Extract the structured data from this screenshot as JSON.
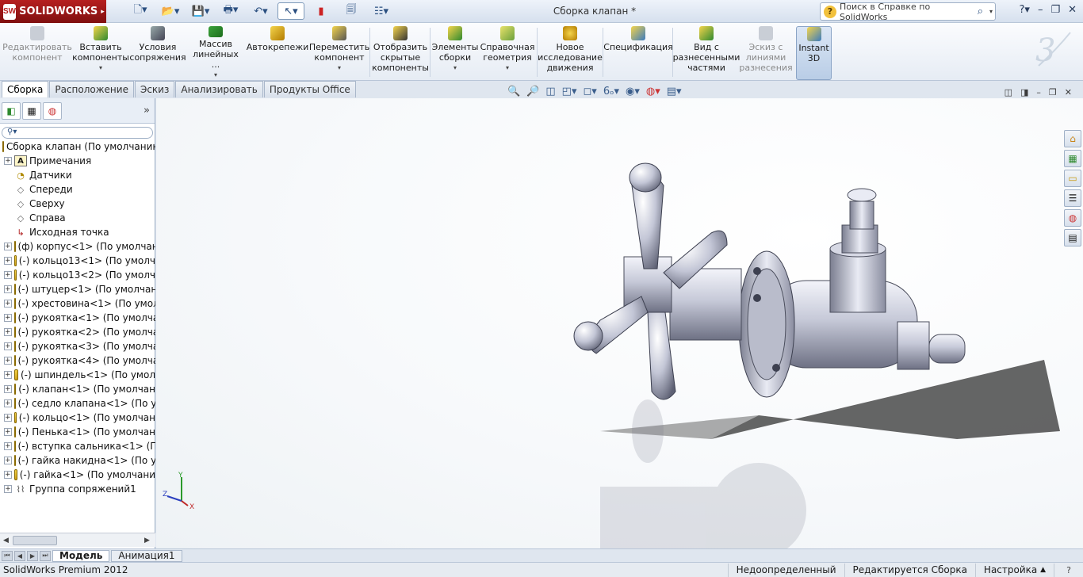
{
  "app": {
    "logo_text": "SOLIDWORKS",
    "logo_mark": "SW",
    "document_title": "Сборка клапан *"
  },
  "quick_access": [
    "new-icon",
    "open-icon",
    "save-icon",
    "print-icon",
    "undo-icon",
    "select-icon",
    "rebuild-icon",
    "file-props-icon",
    "options-icon"
  ],
  "search": {
    "placeholder": "Поиск в Справке по SolidWorks"
  },
  "ribbon": [
    {
      "label": "Редактировать\nкомпонент",
      "disabled": true
    },
    {
      "label": "Вставить\nкомпоненты",
      "dropdown": true
    },
    {
      "label": "Условия\nсопряжения"
    },
    {
      "label": "Массив\nлинейных ...",
      "dropdown": true
    },
    {
      "label": "Автокрепежи"
    },
    {
      "label": "Переместить\nкомпонент",
      "dropdown": true
    },
    {
      "label": "Отобразить\nскрытые\nкомпоненты"
    },
    {
      "label": "Элементы\nсборки",
      "dropdown": true
    },
    {
      "label": "Справочная\nгеометрия",
      "dropdown": true
    },
    {
      "label": "Новое\nисследование\nдвижения"
    },
    {
      "label": "Спецификация"
    },
    {
      "label": "Вид с\nразнесенными\nчастями"
    },
    {
      "label": "Эскиз с\nлиниями\nразнесения",
      "disabled": true
    },
    {
      "label": "Instant\n3D",
      "active": true
    }
  ],
  "tabs": [
    "Сборка",
    "Расположение",
    "Эскиз",
    "Анализировать",
    "Продукты Office"
  ],
  "tree": {
    "root": "Сборка клапан  (По умолчанию",
    "items": [
      {
        "label": "Примечания",
        "icon": "note",
        "exp": true
      },
      {
        "label": "Датчики",
        "icon": "sensor",
        "exp": false
      },
      {
        "label": "Спереди",
        "icon": "plane",
        "exp": false
      },
      {
        "label": "Сверху",
        "icon": "plane",
        "exp": false
      },
      {
        "label": "Справа",
        "icon": "plane",
        "exp": false
      },
      {
        "label": "Исходная точка",
        "icon": "origin",
        "exp": false
      },
      {
        "label": "(ф) корпус<1> (По умолчан",
        "icon": "part",
        "exp": true
      },
      {
        "label": "(-) кольцо13<1> (По умолч",
        "icon": "part",
        "exp": true
      },
      {
        "label": "(-) кольцо13<2> (По умолч",
        "icon": "part",
        "exp": true
      },
      {
        "label": "(-) штуцер<1> (По умолчан",
        "icon": "part",
        "exp": true
      },
      {
        "label": "(-) хрестовина<1> (По умол",
        "icon": "part",
        "exp": true
      },
      {
        "label": "(-) рукоятка<1> (По умолча",
        "icon": "part",
        "exp": true
      },
      {
        "label": "(-) рукоятка<2> (По умолча",
        "icon": "part",
        "exp": true
      },
      {
        "label": "(-) рукоятка<3> (По умолча",
        "icon": "part",
        "exp": true
      },
      {
        "label": "(-) рукоятка<4> (По умолча",
        "icon": "part",
        "exp": true
      },
      {
        "label": "(-) шпиндель<1> (По умол",
        "icon": "part",
        "exp": true
      },
      {
        "label": "(-) клапан<1> (По умолчан",
        "icon": "part",
        "exp": true
      },
      {
        "label": "(-) седло клапана<1> (По у",
        "icon": "part",
        "exp": true
      },
      {
        "label": "(-) кольцо<1> (По умолчан",
        "icon": "part",
        "exp": true
      },
      {
        "label": "(-) Пенька<1> (По умолчан",
        "icon": "part",
        "exp": true
      },
      {
        "label": "(-) вступка сальника<1> (П",
        "icon": "part",
        "exp": true
      },
      {
        "label": "(-) гайка накидна<1> (По ум",
        "icon": "part",
        "exp": true
      },
      {
        "label": "(-) гайка<1> (По умолчани",
        "icon": "part",
        "exp": true
      },
      {
        "label": "Группа сопряжений1",
        "icon": "mate",
        "exp": true
      }
    ]
  },
  "triad": {
    "x": "X",
    "y": "Y",
    "z": "Z"
  },
  "bottom_tabs": [
    "Модель",
    "Анимация1"
  ],
  "status": {
    "app": "SolidWorks Premium 2012",
    "state": "Недоопределенный",
    "mode": "Редактируется Сборка",
    "settings": "Настройка"
  },
  "colors": {
    "accent": "#b61f1f",
    "ribbon_bg": "#eef3fa",
    "model": "#c9ccda"
  }
}
